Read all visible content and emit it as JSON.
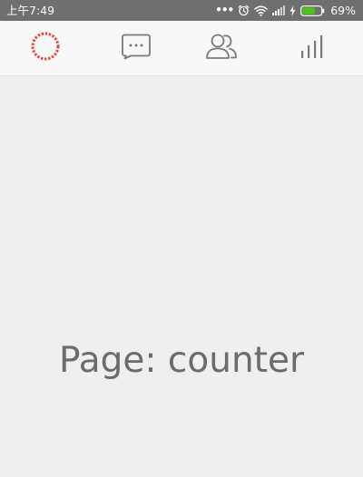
{
  "status_bar": {
    "time": "上午7:49",
    "dots": "•••",
    "battery_percent": "69%",
    "battery_level": 0.69,
    "battery_color": "#4cc417"
  },
  "tabs": [
    {
      "icon": "loading-ring-icon",
      "active": true
    },
    {
      "icon": "chat-bubble-icon",
      "active": false
    },
    {
      "icon": "contacts-icon",
      "active": false
    },
    {
      "icon": "bar-chart-icon",
      "active": false
    }
  ],
  "colors": {
    "active": "#e8463a",
    "inactive": "#7a7a7a",
    "status_bar_bg": "#6f6f6f",
    "background": "#efefef"
  },
  "main": {
    "page_label": "Page: counter"
  }
}
